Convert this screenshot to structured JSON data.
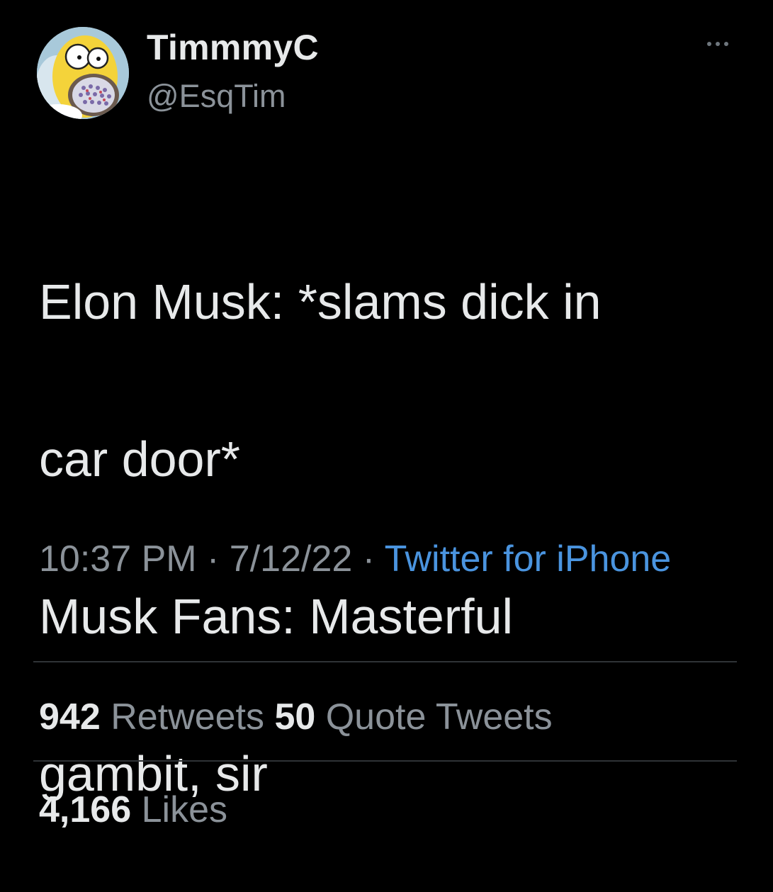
{
  "user": {
    "display_name": "TimmmyC",
    "handle": "@EsqTim",
    "avatar_icon": "homer-avatar"
  },
  "menu": {
    "icon": "more-horizontal-icon"
  },
  "tweet": {
    "lines": [
      "Elon Musk: *slams dick in",
      "car door*",
      "Musk Fans: Masterful",
      "gambit, sir"
    ]
  },
  "meta": {
    "time": "10:37 PM",
    "separator1": " · ",
    "date": "7/12/22",
    "separator2": " · ",
    "source": "Twitter for iPhone"
  },
  "stats": {
    "retweets_count": "942",
    "retweets_label": "Retweets",
    "quotes_count": "50",
    "quotes_label": "Quote Tweets",
    "likes_count": "4,166",
    "likes_label": "Likes"
  },
  "colors": {
    "background": "#000000",
    "text": "#e7e9ea",
    "secondary": "#8b9299",
    "link": "#4a94df",
    "divider": "#2f3336"
  }
}
